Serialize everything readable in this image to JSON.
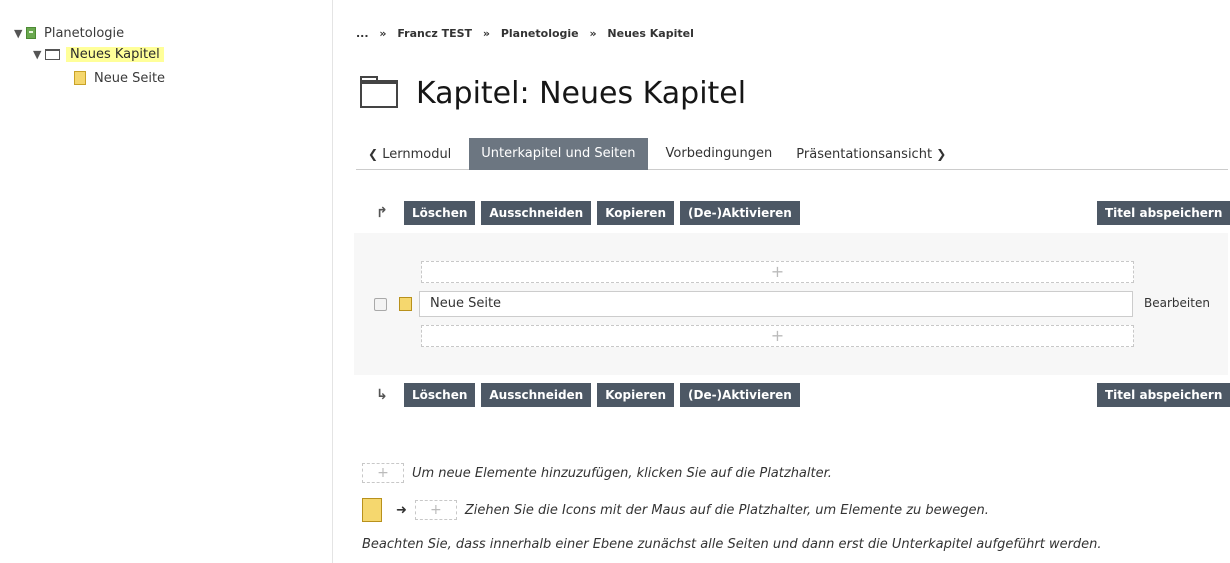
{
  "tree": {
    "root_label": "Planetologie",
    "chapter_label": "Neues Kapitel",
    "page_label": "Neue Seite"
  },
  "breadcrumb": {
    "ellipsis": "...",
    "separator": "»",
    "items": [
      "Francz TEST",
      "Planetologie",
      "Neues Kapitel"
    ]
  },
  "page_title": "Kapitel: Neues Kapitel",
  "tabs": {
    "back": "Lernmodul",
    "active": "Unterkapitel und Seiten",
    "prereq": "Vorbedingungen",
    "presentation": "Präsentationsansicht"
  },
  "toolbar": {
    "delete": "Löschen",
    "cut": "Ausschneiden",
    "copy": "Kopieren",
    "toggle": "(De-)Aktivieren",
    "save_titles": "Titel abspeichern"
  },
  "editor": {
    "placeholder_symbol": "+",
    "item_title": "Neue Seite",
    "edit_link": "Bearbeiten"
  },
  "help": {
    "add_hint": "Um neue Elemente hinzuzufügen, klicken Sie auf die Platzhalter.",
    "drag_hint": "Ziehen Sie die Icons mit der Maus auf die Platzhalter, um Elemente zu bewegen.",
    "order_hint": "Beachten Sie, dass innerhalb einer Ebene zunächst alle Seiten und dann erst die Unterkapitel aufgeführt werden."
  },
  "colors": {
    "button_bg": "#4d5865",
    "tab_active_bg": "#6c7681",
    "highlight": "#ffff99",
    "page_icon": "#f5d76e",
    "book_icon": "#6aa84f"
  }
}
